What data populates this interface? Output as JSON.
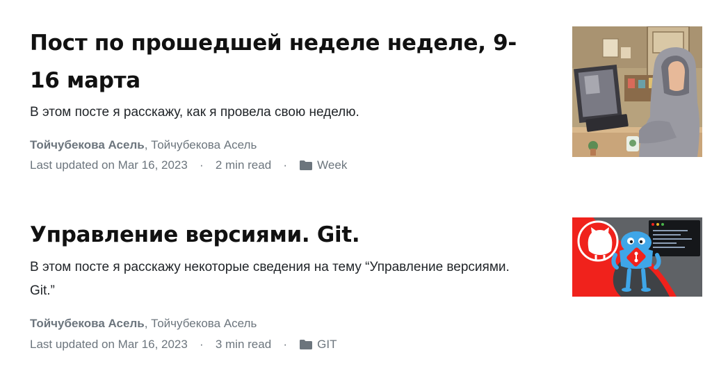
{
  "posts": [
    {
      "title": "Пост по прошедшей неделе неделе, 9-16 марта",
      "description": "В этом посте я расскажу, как я провела свою неделю.",
      "lead_author": "Тойчубекова Асель",
      "separator": ", ",
      "co_author": "Тойчубекова Асель",
      "updated": "Last updated on Mar 16, 2023",
      "read_time": "2 min read",
      "category": "Week",
      "thumbnail_icon": "illustration-girl-at-computer"
    },
    {
      "title": "Управление версиями. Git.",
      "description": "В этом посте я расскажу некоторые сведения на тему “Управление версиями. Git.”",
      "lead_author": "Тойчубекова Асель",
      "separator": ", ",
      "co_author": "Тойчубекова Асель",
      "updated": "Last updated on Mar 16, 2023",
      "read_time": "3 min read",
      "category": "GIT",
      "thumbnail_icon": "illustration-git-mascot"
    }
  ],
  "meta_dot": "·",
  "colors": {
    "title": "#111111",
    "text": "#212529",
    "muted": "#6c757d",
    "git_red": "#f0221c"
  }
}
